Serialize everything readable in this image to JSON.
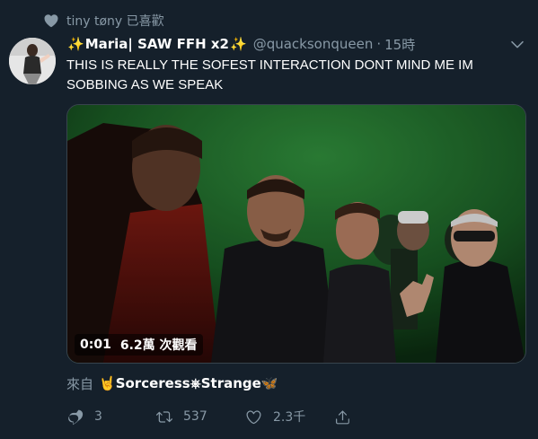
{
  "social_context": {
    "text": "tiny tøny 已喜歡"
  },
  "tweet": {
    "display_name": "Maria| SAW FFH x2",
    "sparkle_left": "✨",
    "sparkle_right": "✨",
    "handle": "@quacksonqueen",
    "dot": "·",
    "time": "15時",
    "text": "THIS IS REALLY THE SOFEST INTERACTION DONT MIND ME IM SOBBING AS WE SPEAK"
  },
  "video": {
    "duration": "0:01",
    "views": "6.2萬 次觀看"
  },
  "source": {
    "label": "來自",
    "name_prefix": "🤘",
    "name": "Sorceress",
    "separator": "⎈",
    "name2": "Strange",
    "name_suffix": "🦋"
  },
  "actions": {
    "reply_count": "3",
    "retweet_count": "537",
    "like_count": "2.3千"
  },
  "colors": {
    "background": "#15202b",
    "secondary_text": "#8899a6",
    "border": "#38444d"
  }
}
